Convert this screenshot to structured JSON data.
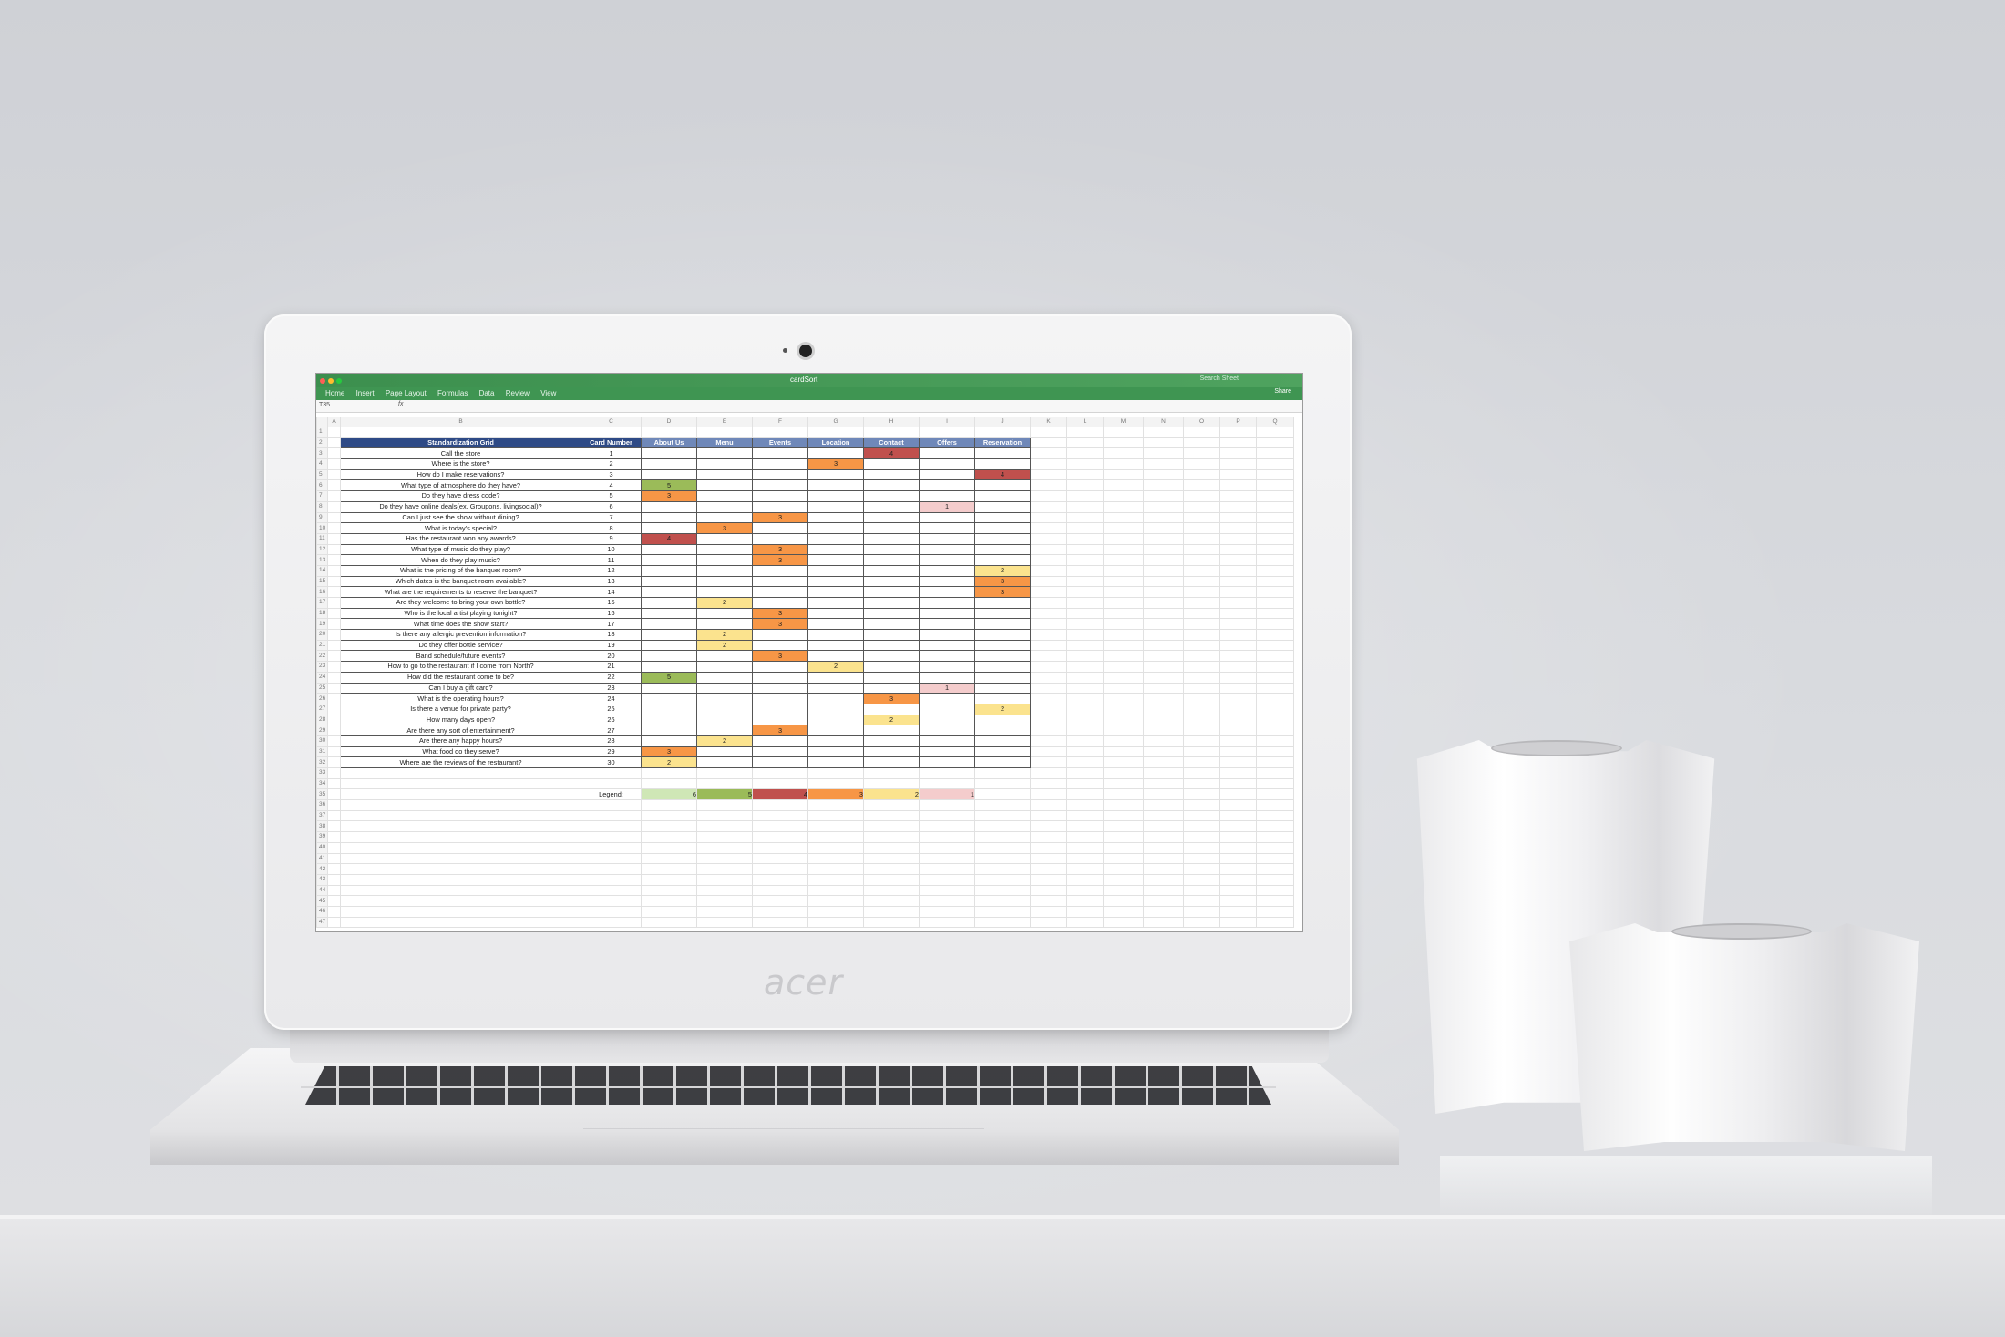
{
  "laptop": {
    "brand": "acer"
  },
  "window": {
    "title": "cardSort",
    "search_placeholder": "Search Sheet",
    "share_label": "Share"
  },
  "ribbon_tabs": [
    "Home",
    "Insert",
    "Page Layout",
    "Formulas",
    "Data",
    "Review",
    "View"
  ],
  "formula_bar": {
    "cell_ref": "T35",
    "fx_label": "fx"
  },
  "column_letters": [
    "A",
    "B",
    "C",
    "D",
    "E",
    "F",
    "G",
    "H",
    "I",
    "J",
    "K",
    "L",
    "M",
    "N",
    "O",
    "P",
    "Q"
  ],
  "colors": {
    "score_6": "#cfe7b6",
    "score_5": "#9bbb59",
    "score_4": "#c0504d",
    "score_3": "#f79646",
    "score_2": "#fbe38e",
    "score_1": "#f4cccc",
    "header_main": "#2e4a86",
    "header_cat": "#6f88b9",
    "titlebar": "#3c8f4e"
  },
  "grid": {
    "title": "Standardization Grid",
    "card_number_header": "Card Number",
    "categories": [
      "About Us",
      "Menu",
      "Events",
      "Location",
      "Contact",
      "Offers",
      "Reservation"
    ],
    "rows": [
      {
        "row": "3",
        "card": "Call the store",
        "num": "1",
        "scores": [
          "",
          "",
          "",
          "",
          "4",
          "",
          ""
        ]
      },
      {
        "row": "4",
        "card": "Where is the store?",
        "num": "2",
        "scores": [
          "",
          "",
          "",
          "3",
          "",
          "",
          ""
        ]
      },
      {
        "row": "5",
        "card": "How do I make reservations?",
        "num": "3",
        "scores": [
          "",
          "",
          "",
          "",
          "",
          "",
          "4"
        ]
      },
      {
        "row": "6",
        "card": "What type of atmosphere do they have?",
        "num": "4",
        "scores": [
          "5",
          "",
          "",
          "",
          "",
          "",
          ""
        ]
      },
      {
        "row": "7",
        "card": "Do they have dress code?",
        "num": "5",
        "scores": [
          "3",
          "",
          "",
          "",
          "",
          "",
          ""
        ]
      },
      {
        "row": "8",
        "card": "Do they have online deals(ex. Groupons, livingsocial)?",
        "num": "6",
        "scores": [
          "",
          "",
          "",
          "",
          "",
          "1",
          ""
        ]
      },
      {
        "row": "9",
        "card": "Can I just see the show without dining?",
        "num": "7",
        "scores": [
          "",
          "",
          "3",
          "",
          "",
          "",
          ""
        ]
      },
      {
        "row": "10",
        "card": "What is today's special?",
        "num": "8",
        "scores": [
          "",
          "3",
          "",
          "",
          "",
          "",
          ""
        ]
      },
      {
        "row": "11",
        "card": "Has the restaurant won any awards?",
        "num": "9",
        "scores": [
          "4",
          "",
          "",
          "",
          "",
          "",
          ""
        ]
      },
      {
        "row": "12",
        "card": "What type of music do they play?",
        "num": "10",
        "scores": [
          "",
          "",
          "3",
          "",
          "",
          "",
          ""
        ]
      },
      {
        "row": "13",
        "card": "When do they play music?",
        "num": "11",
        "scores": [
          "",
          "",
          "3",
          "",
          "",
          "",
          ""
        ]
      },
      {
        "row": "14",
        "card": "What is the pricing of the banquet room?",
        "num": "12",
        "scores": [
          "",
          "",
          "",
          "",
          "",
          "",
          "2"
        ]
      },
      {
        "row": "15",
        "card": "Which dates is the banquet room available?",
        "num": "13",
        "scores": [
          "",
          "",
          "",
          "",
          "",
          "",
          "3"
        ]
      },
      {
        "row": "16",
        "card": "What are the requirements to reserve the banquet?",
        "num": "14",
        "scores": [
          "",
          "",
          "",
          "",
          "",
          "",
          "3"
        ]
      },
      {
        "row": "17",
        "card": "Are they welcome to bring your own bottle?",
        "num": "15",
        "scores": [
          "",
          "2",
          "",
          "",
          "",
          "",
          ""
        ]
      },
      {
        "row": "18",
        "card": "Who is the local artist playing tonight?",
        "num": "16",
        "scores": [
          "",
          "",
          "3",
          "",
          "",
          "",
          ""
        ]
      },
      {
        "row": "19",
        "card": "What time does the show start?",
        "num": "17",
        "scores": [
          "",
          "",
          "3",
          "",
          "",
          "",
          ""
        ]
      },
      {
        "row": "20",
        "card": "Is there any allergic prevention information?",
        "num": "18",
        "scores": [
          "",
          "2",
          "",
          "",
          "",
          "",
          ""
        ]
      },
      {
        "row": "21",
        "card": "Do they offer bottle service?",
        "num": "19",
        "scores": [
          "",
          "2",
          "",
          "",
          "",
          "",
          ""
        ]
      },
      {
        "row": "22",
        "card": "Band schedule/future events?",
        "num": "20",
        "scores": [
          "",
          "",
          "3",
          "",
          "",
          "",
          ""
        ]
      },
      {
        "row": "23",
        "card": "How to go to the restaurant if I come from North?",
        "num": "21",
        "scores": [
          "",
          "",
          "",
          "2",
          "",
          "",
          ""
        ]
      },
      {
        "row": "24",
        "card": "How did the restaurant come to be?",
        "num": "22",
        "scores": [
          "5",
          "",
          "",
          "",
          "",
          "",
          ""
        ]
      },
      {
        "row": "25",
        "card": "Can I buy a gift card?",
        "num": "23",
        "scores": [
          "",
          "",
          "",
          "",
          "",
          "1",
          ""
        ]
      },
      {
        "row": "26",
        "card": "What is the operating hours?",
        "num": "24",
        "scores": [
          "",
          "",
          "",
          "",
          "3",
          "",
          ""
        ]
      },
      {
        "row": "27",
        "card": "Is there a venue for private party?",
        "num": "25",
        "scores": [
          "",
          "",
          "",
          "",
          "",
          "",
          "2"
        ]
      },
      {
        "row": "28",
        "card": "How many days open?",
        "num": "26",
        "scores": [
          "",
          "",
          "",
          "",
          "2",
          "",
          ""
        ]
      },
      {
        "row": "29",
        "card": "Are there any sort of entertainment?",
        "num": "27",
        "scores": [
          "",
          "",
          "3",
          "",
          "",
          "",
          ""
        ]
      },
      {
        "row": "30",
        "card": "Are there any happy hours?",
        "num": "28",
        "scores": [
          "",
          "2",
          "",
          "",
          "",
          "",
          ""
        ]
      },
      {
        "row": "31",
        "card": "What food do they serve?",
        "num": "29",
        "scores": [
          "3",
          "",
          "",
          "",
          "",
          "",
          ""
        ]
      },
      {
        "row": "32",
        "card": "Where are the reviews of the restaurant?",
        "num": "30",
        "scores": [
          "2",
          "",
          "",
          "",
          "",
          "",
          ""
        ]
      }
    ],
    "legend_label": "Legend:",
    "legend_values": [
      "6",
      "5",
      "4",
      "3",
      "2",
      "1"
    ]
  }
}
